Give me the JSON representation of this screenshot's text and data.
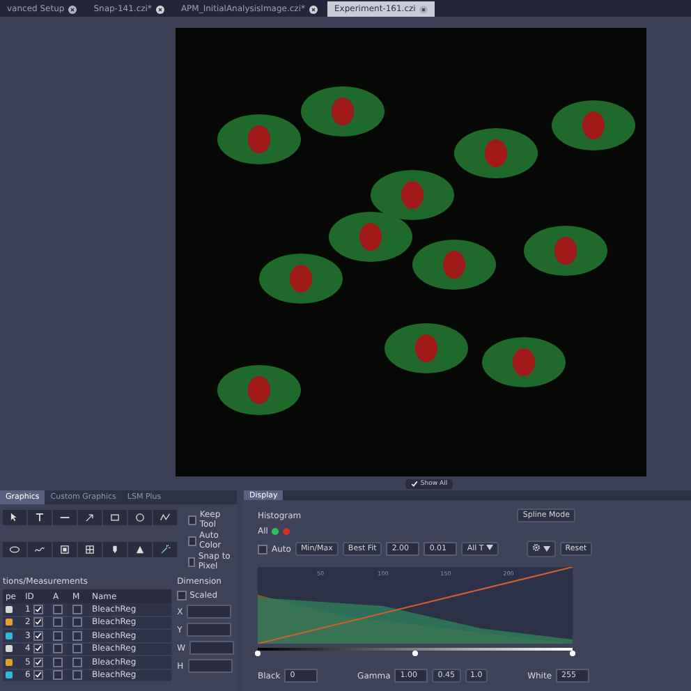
{
  "document_tabs": [
    {
      "label": "vanced Setup",
      "selected": false,
      "modified": false
    },
    {
      "label": "Snap-141.czi*",
      "selected": false,
      "modified": true
    },
    {
      "label": "APM_InitialAnalysisImage.czi*",
      "selected": false,
      "modified": true
    },
    {
      "label": "Experiment-161.czi",
      "selected": true,
      "modified": false
    }
  ],
  "show_all": {
    "label": "Show All",
    "checked": true
  },
  "left_panel": {
    "tabs": [
      {
        "label": "Graphics",
        "selected": true
      },
      {
        "label": "Custom Graphics",
        "selected": false
      },
      {
        "label": "LSM Plus",
        "selected": false
      }
    ],
    "options": [
      {
        "label": "Keep Tool",
        "checked": false
      },
      {
        "label": "Auto Color",
        "checked": false
      },
      {
        "label": "Snap to Pixel",
        "checked": false
      }
    ],
    "list_title": "tions/Measurements",
    "columns": [
      "pe",
      "ID",
      "A",
      "M",
      "Name"
    ],
    "rows": [
      {
        "id": "1",
        "visible": true,
        "a": false,
        "m": false,
        "name": "BleachReg",
        "color": "#d8d8d8"
      },
      {
        "id": "2",
        "visible": true,
        "a": false,
        "m": false,
        "name": "BleachReg",
        "color": "#e0a030"
      },
      {
        "id": "3",
        "visible": true,
        "a": false,
        "m": false,
        "name": "BleachReg",
        "color": "#30b8d8"
      },
      {
        "id": "4",
        "visible": true,
        "a": false,
        "m": false,
        "name": "BleachReg",
        "color": "#d8d8d8"
      },
      {
        "id": "5",
        "visible": true,
        "a": false,
        "m": false,
        "name": "BleachReg",
        "color": "#e0a030"
      },
      {
        "id": "6",
        "visible": true,
        "a": false,
        "m": false,
        "name": "BleachReg",
        "color": "#30b8d8"
      }
    ],
    "dimension": {
      "title": "Dimension",
      "scaled": {
        "label": "Scaled",
        "checked": false
      },
      "fields": [
        "X",
        "Y",
        "W",
        "H"
      ]
    }
  },
  "display_panel": {
    "tab": "Display",
    "histogram_title": "Histogram",
    "spline_button": "Spline Mode",
    "channels_label": "All",
    "channels": [
      {
        "color": "#30c060"
      },
      {
        "color": "#d03030"
      }
    ],
    "auto": {
      "label": "Auto",
      "checked": false
    },
    "buttons": [
      "Min/Max",
      "Best Fit"
    ],
    "value_1": "2.00",
    "value_2": "0.01",
    "time_dropdown": "All T",
    "reset_button": "Reset",
    "scale_labels": [
      "50",
      "100",
      "150",
      "200"
    ],
    "handles": [
      {
        "level": 0
      },
      {
        "level": 0.5
      },
      {
        "level": 1
      }
    ],
    "black": {
      "label": "Black",
      "value": "0"
    },
    "gamma": {
      "label": "Gamma",
      "value": "1.00"
    },
    "gamma_presets": [
      "0.45",
      "1.0"
    ],
    "white": {
      "label": "White",
      "value": "255"
    }
  }
}
